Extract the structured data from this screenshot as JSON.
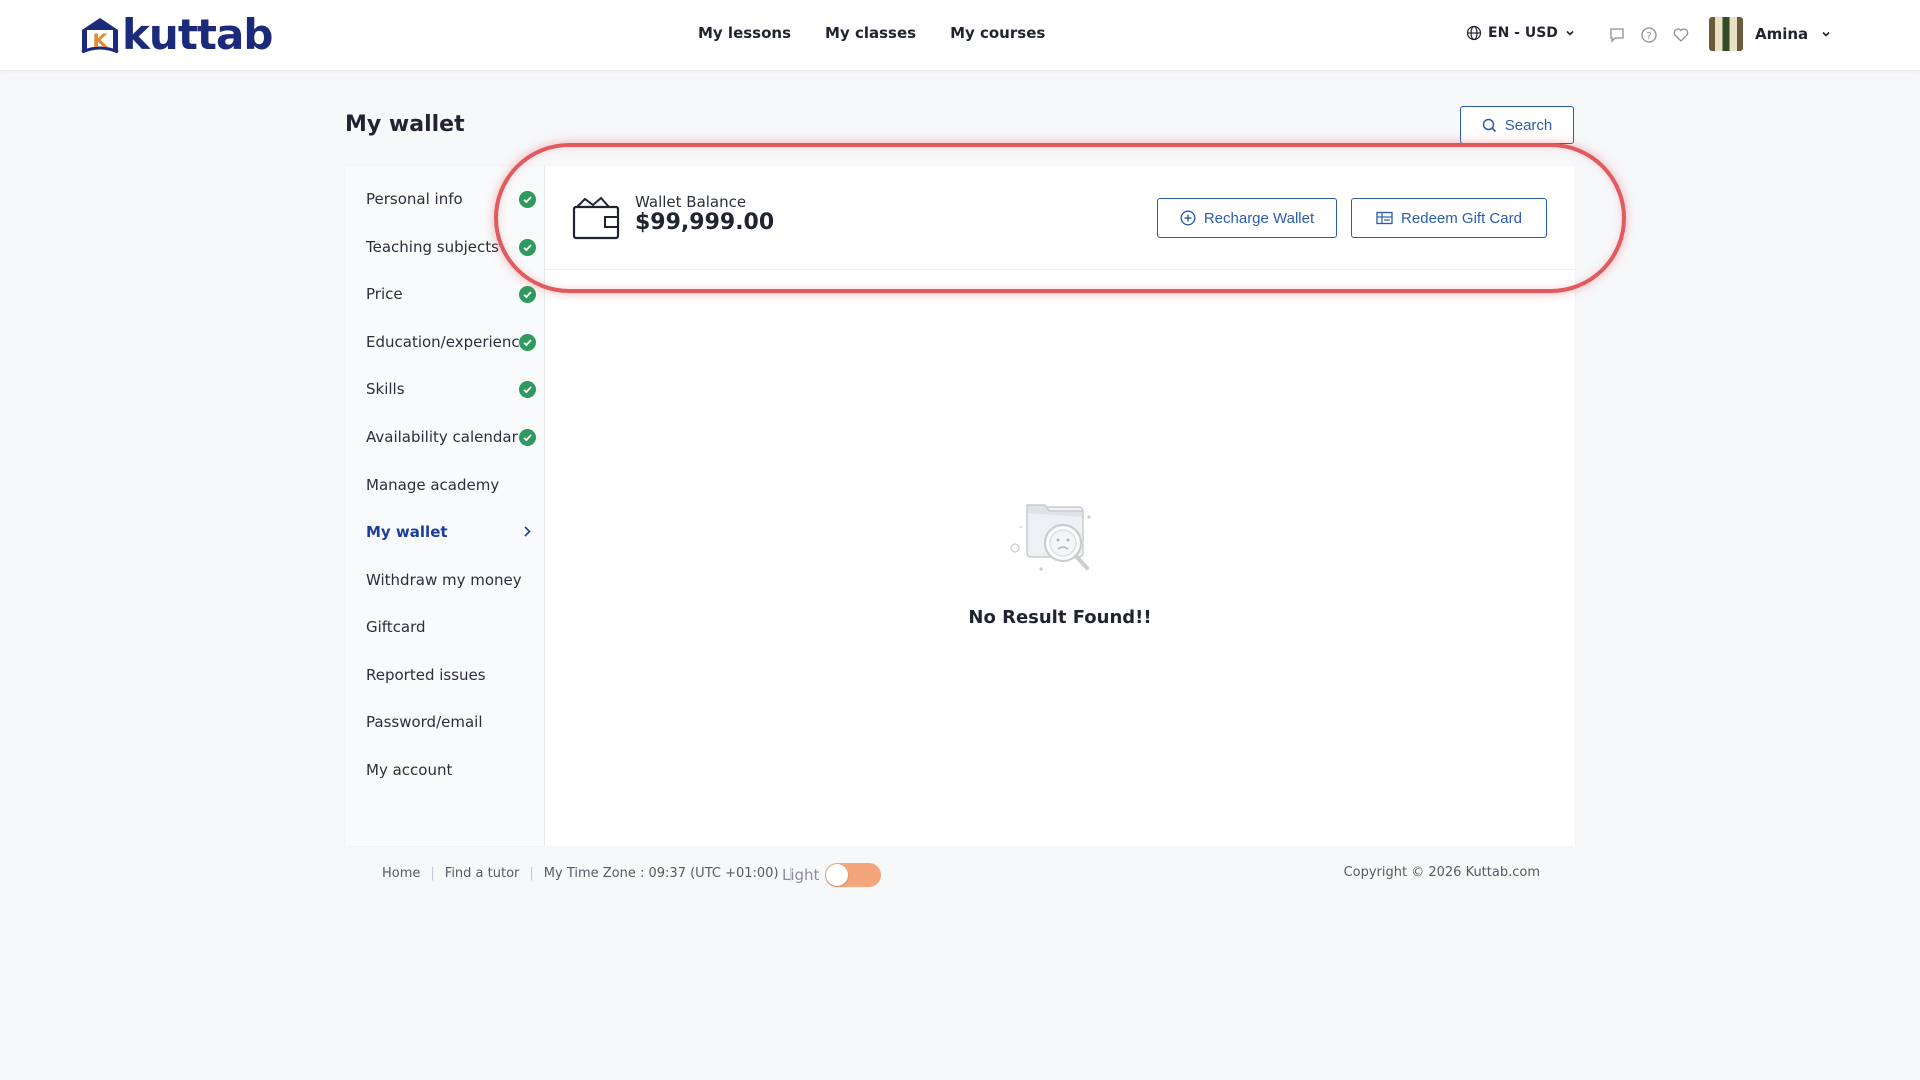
{
  "brand": {
    "name": "kuttab",
    "logo_letter": "K",
    "color": "#1b2a7a",
    "accent": "#e58a2e"
  },
  "nav": {
    "items": [
      "My lessons",
      "My classes",
      "My courses"
    ]
  },
  "locale": {
    "label": "EN - USD",
    "icon": "globe-icon"
  },
  "header_icons": [
    "chat-icon",
    "help-icon",
    "heart-icon"
  ],
  "user": {
    "name": "Amina"
  },
  "page": {
    "title": "My wallet",
    "search_label": "Search"
  },
  "sidebar": {
    "items": [
      {
        "label": "Personal info",
        "state": "complete"
      },
      {
        "label": "Teaching subjects",
        "state": "complete"
      },
      {
        "label": "Price",
        "state": "complete"
      },
      {
        "label": "Education/experience",
        "state": "complete"
      },
      {
        "label": "Skills",
        "state": "complete"
      },
      {
        "label": "Availability calendar",
        "state": "complete"
      },
      {
        "label": "Manage academy",
        "state": "none"
      },
      {
        "label": "My wallet",
        "state": "active"
      },
      {
        "label": "Withdraw my money",
        "state": "none"
      },
      {
        "label": "Giftcard",
        "state": "none"
      },
      {
        "label": "Reported issues",
        "state": "none"
      },
      {
        "label": "Password/email",
        "state": "none"
      },
      {
        "label": "My account",
        "state": "none"
      }
    ]
  },
  "wallet": {
    "balance_label": "Wallet Balance",
    "balance_value": "$99,999.00",
    "recharge_label": "Recharge Wallet",
    "redeem_label": "Redeem Gift Card"
  },
  "empty_state": {
    "message": "No Result Found!!"
  },
  "footer": {
    "links": [
      "Home",
      "Find a tutor"
    ],
    "timezone": "My Time Zone : 09:37 (UTC +01:00)",
    "theme_label": "Light",
    "copyright": "Copyright © 2026 Kuttab.com"
  },
  "colors": {
    "primary": "#2a5cae",
    "success": "#2e9a5f",
    "highlight": "#e05a5e",
    "toggle": "#f3a57c"
  }
}
